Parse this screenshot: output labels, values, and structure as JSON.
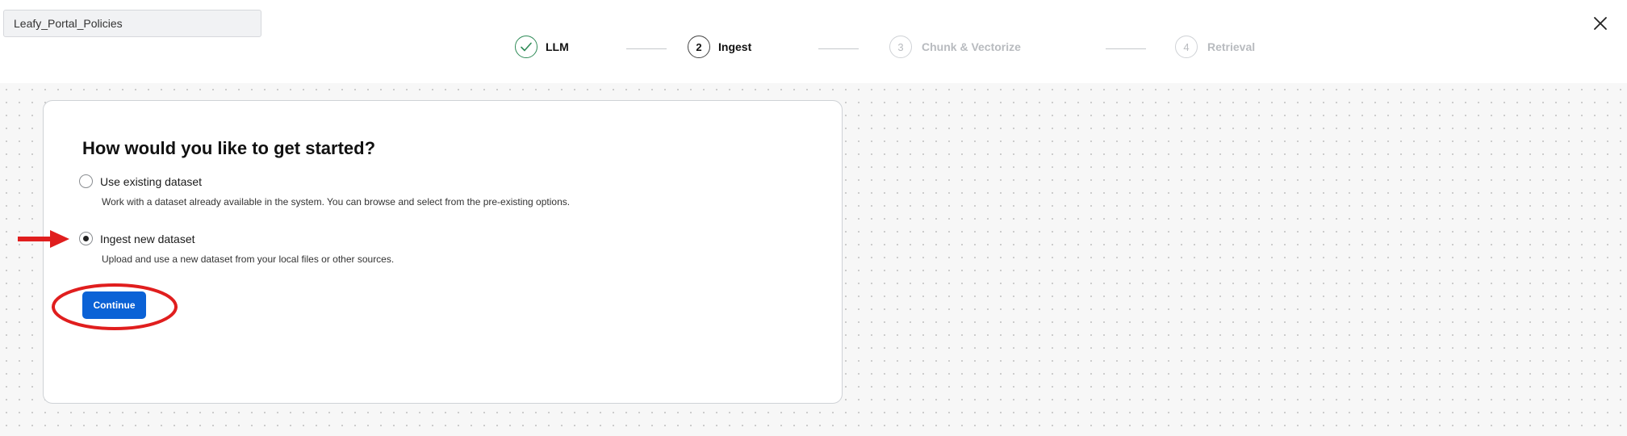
{
  "header": {
    "project_name": "Leafy_Portal_Policies",
    "close_icon": "close-icon"
  },
  "stepper": {
    "steps": [
      {
        "number": "",
        "label": "LLM",
        "state": "completed"
      },
      {
        "number": "2",
        "label": "Ingest",
        "state": "active"
      },
      {
        "number": "3",
        "label": "Chunk & Vectorize",
        "state": "pending"
      },
      {
        "number": "4",
        "label": "Retrieval",
        "state": "pending"
      }
    ]
  },
  "card": {
    "title": "How would you like to get started?",
    "options": [
      {
        "label": "Use existing dataset",
        "description": "Work with a dataset already available in the system. You can browse and select from the pre-existing options.",
        "selected": false
      },
      {
        "label": "Ingest new dataset",
        "description": "Upload and use a new dataset from your local files or other sources.",
        "selected": true
      }
    ],
    "continue_label": "Continue"
  },
  "colors": {
    "primary_button": "#0b62d6",
    "step_done": "#2e8b57",
    "annotation_red": "#e01e1e"
  }
}
